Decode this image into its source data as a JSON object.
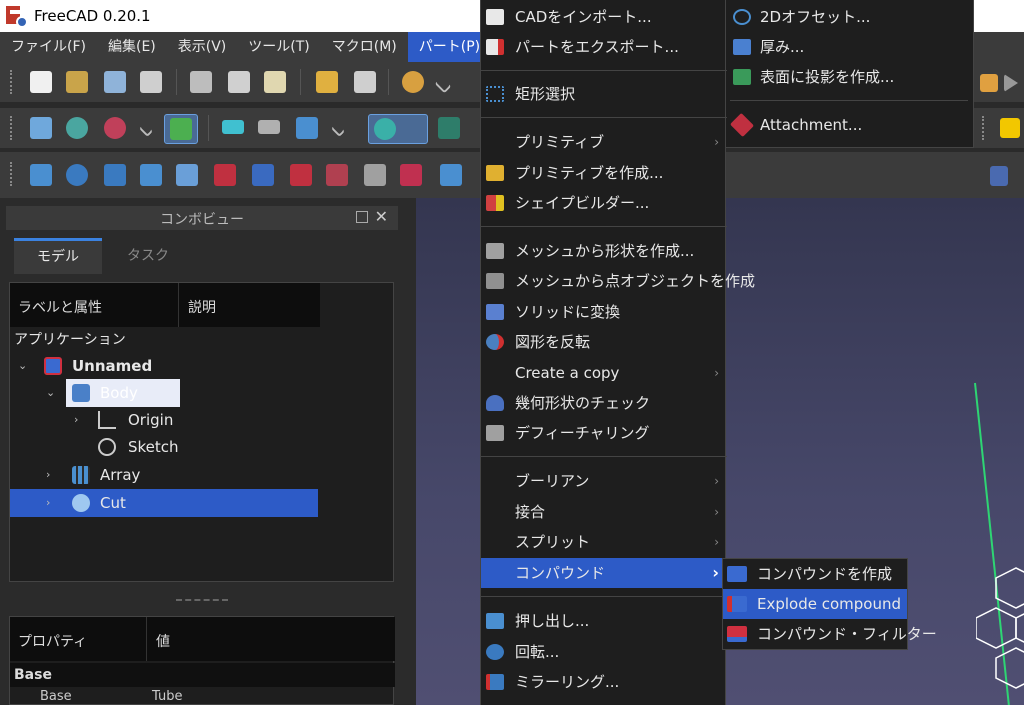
{
  "window": {
    "title": "FreeCAD 0.20.1"
  },
  "menubar": {
    "items": [
      "ファイル(F)",
      "編集(E)",
      "表示(V)",
      "ツール(T)",
      "マクロ(M)",
      "パート(P)"
    ],
    "active_index": 5
  },
  "combo": {
    "title": "コンボビュー",
    "tabs": [
      "モデル",
      "タスク"
    ],
    "tree_headers": [
      "ラベルと属性",
      "説明"
    ],
    "application_label": "アプリケーション",
    "tree": [
      {
        "label": "Unnamed",
        "depth": 0,
        "expanded": true
      },
      {
        "label": "Body",
        "depth": 1,
        "expanded": true,
        "selected": "light"
      },
      {
        "label": "Origin",
        "depth": 2,
        "expanded": false
      },
      {
        "label": "Sketch",
        "depth": 2
      },
      {
        "label": "Array",
        "depth": 1,
        "expanded": false
      },
      {
        "label": "Cut",
        "depth": 1,
        "expanded": false,
        "selected": "blue"
      }
    ],
    "props_headers": [
      "プロパティ",
      "値"
    ],
    "props_group": "Base",
    "props_row": {
      "name": "Base",
      "value": "Tube"
    }
  },
  "part_menu": {
    "items": [
      {
        "label": "CADをインポート...",
        "icon": "import-icon"
      },
      {
        "label": "パートをエクスポート...",
        "icon": "export-icon"
      },
      {
        "sep": true
      },
      {
        "label": "矩形選択",
        "icon": "box-select-icon"
      },
      {
        "sep": true
      },
      {
        "label": "プリミティブ",
        "submenu": true
      },
      {
        "label": "プリミティブを作成...",
        "icon": "primitives-icon"
      },
      {
        "label": "シェイプビルダー...",
        "icon": "shapebuilder-icon"
      },
      {
        "sep": true
      },
      {
        "label": "メッシュから形状を作成...",
        "icon": "mesh-shape-icon"
      },
      {
        "label": "メッシュから点オブジェクトを作成",
        "icon": "mesh-points-icon"
      },
      {
        "label": "ソリッドに変換",
        "icon": "solid-icon"
      },
      {
        "label": "図形を反転",
        "icon": "reverse-icon"
      },
      {
        "label": "Create a copy",
        "submenu": true
      },
      {
        "label": "幾何形状のチェック",
        "icon": "check-geometry-icon"
      },
      {
        "label": "デフィーチャリング",
        "icon": "defeaturing-icon"
      },
      {
        "sep": true
      },
      {
        "label": "ブーリアン",
        "submenu": true
      },
      {
        "label": "接合",
        "submenu": true
      },
      {
        "label": "スプリット",
        "submenu": true
      },
      {
        "label": "コンパウンド",
        "submenu": true,
        "highlighted": true
      },
      {
        "sep": true
      },
      {
        "label": "押し出し...",
        "icon": "extrude-icon"
      },
      {
        "label": "回転...",
        "icon": "revolve-icon"
      },
      {
        "label": "ミラーリング...",
        "icon": "mirror-icon"
      }
    ]
  },
  "side_menu": {
    "items": [
      {
        "label": "2Dオフセット...",
        "icon": "offset2d-icon"
      },
      {
        "label": "厚み...",
        "icon": "thickness-icon"
      },
      {
        "label": "表面に投影を作成...",
        "icon": "projection-icon"
      },
      {
        "label": "Attachment...",
        "icon": "attachment-icon"
      }
    ]
  },
  "compound_submenu": {
    "items": [
      {
        "label": "コンパウンドを作成",
        "icon": "make-compound-icon"
      },
      {
        "label": "Explode compound",
        "icon": "explode-compound-icon",
        "highlighted": true
      },
      {
        "label": "コンパウンド・フィルター",
        "icon": "compound-filter-icon"
      }
    ]
  },
  "colors": {
    "accent": "#2d5bc7",
    "menu_bg": "#1e1e1e",
    "toolbar_bg": "#3b3b3b"
  }
}
